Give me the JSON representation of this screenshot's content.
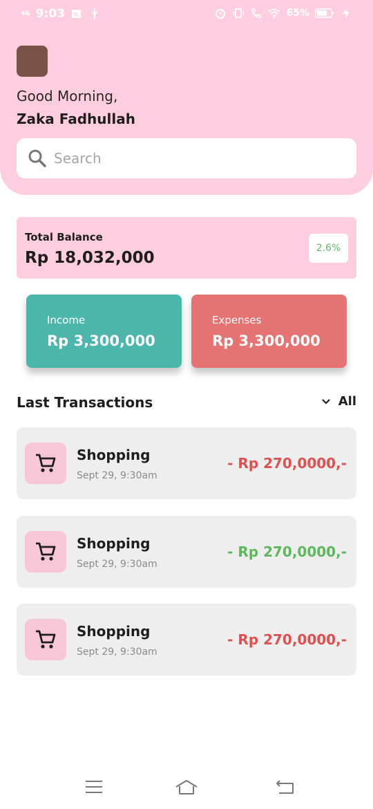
{
  "status_bar": {
    "network": "4G",
    "time": "9:03",
    "battery": "65%"
  },
  "header": {
    "greeting": "Good Morning,",
    "user_name": "Zaka Fadhullah",
    "avatar_color": "#7a5347",
    "background_color": "#ffcde0"
  },
  "search": {
    "placeholder": "Search",
    "value": ""
  },
  "balance": {
    "label": "Total Balance",
    "amount": "Rp 18,032,000",
    "change": "2.6%",
    "change_color": "#5fb96b"
  },
  "stats": {
    "income": {
      "label": "Income",
      "value": "Rp 3,300,000",
      "color": "#4db6ac"
    },
    "expenses": {
      "label": "Expenses",
      "value": "Rp 3,300,000",
      "color": "#e57373"
    }
  },
  "transactions": {
    "title": "Last Transactions",
    "filter_label": "All",
    "items": [
      {
        "title": "Shopping",
        "date": "Sept 29, 9:30am",
        "amount": "- Rp 270,0000,-",
        "amount_color": "#e05050",
        "icon": "cart-icon"
      },
      {
        "title": "Shopping",
        "date": "Sept 29, 9:30am",
        "amount": "- Rp 270,0000,-",
        "amount_color": "#5cb85c",
        "icon": "cart-icon"
      },
      {
        "title": "Shopping",
        "date": "Sept 29, 9:30am",
        "amount": "- Rp 270,0000,-",
        "amount_color": "#e05050",
        "icon": "cart-icon"
      }
    ]
  },
  "nav": {
    "icons": [
      "menu-icon",
      "home-icon",
      "back-icon"
    ]
  }
}
